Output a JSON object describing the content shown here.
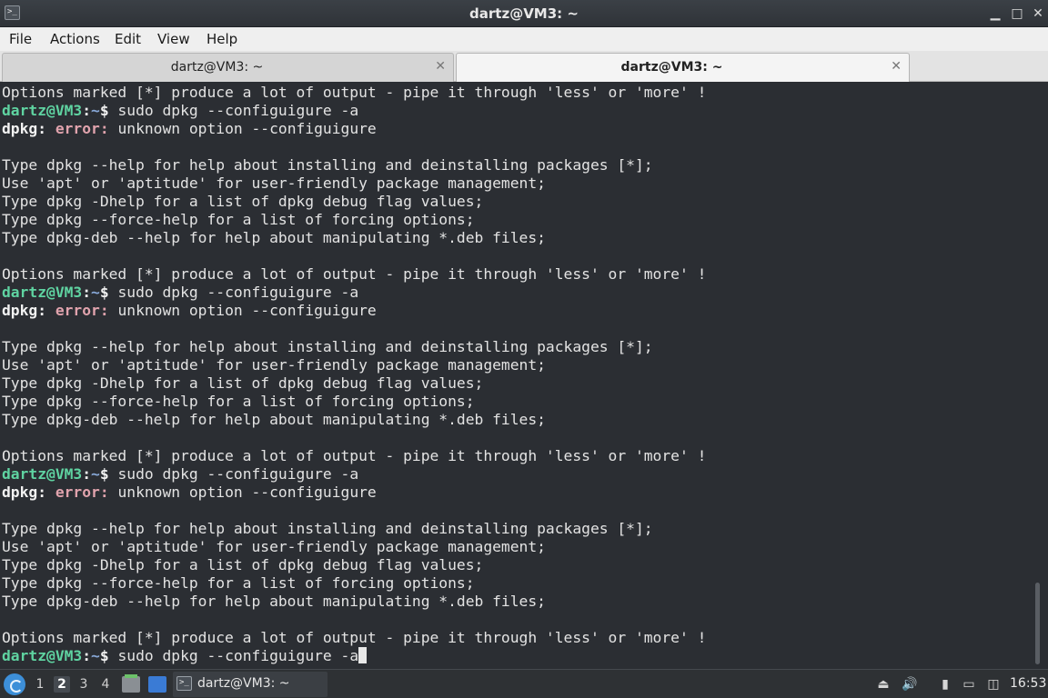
{
  "window": {
    "title": "dartz@VM3: ~",
    "app_icon": ">_",
    "minimize_icon": "▁",
    "maximize_icon": "□",
    "close_icon": "✕"
  },
  "menu": [
    "File",
    "Actions",
    "Edit",
    "View",
    "Help"
  ],
  "tabs": [
    {
      "label": "dartz@VM3: ~",
      "close": "✕",
      "active": false
    },
    {
      "label": "dartz@VM3: ~",
      "close": "✕",
      "active": true
    }
  ],
  "terminal": {
    "lines": [
      {
        "text": "Options marked [*] produce a lot of output - pipe it through 'less' or 'more' !"
      },
      {
        "prompt": {
          "user": "dartz@VM3",
          "sep": ":",
          "path": "~",
          "sym": "$ "
        },
        "cmd": "sudo dpkg --configuigure -a"
      },
      {
        "err": {
          "prog": "dpkg:",
          "label": "error:"
        },
        "text": " unknown option --configuigure"
      },
      {
        "text": ""
      },
      {
        "text": "Type dpkg --help for help about installing and deinstalling packages [*];"
      },
      {
        "text": "Use 'apt' or 'aptitude' for user-friendly package management;"
      },
      {
        "text": "Type dpkg -Dhelp for a list of dpkg debug flag values;"
      },
      {
        "text": "Type dpkg --force-help for a list of forcing options;"
      },
      {
        "text": "Type dpkg-deb --help for help about manipulating *.deb files;"
      },
      {
        "text": ""
      },
      {
        "text": "Options marked [*] produce a lot of output - pipe it through 'less' or 'more' !"
      },
      {
        "prompt": {
          "user": "dartz@VM3",
          "sep": ":",
          "path": "~",
          "sym": "$ "
        },
        "cmd": "sudo dpkg --configuigure -a"
      },
      {
        "err": {
          "prog": "dpkg:",
          "label": "error:"
        },
        "text": " unknown option --configuigure"
      },
      {
        "text": ""
      },
      {
        "text": "Type dpkg --help for help about installing and deinstalling packages [*];"
      },
      {
        "text": "Use 'apt' or 'aptitude' for user-friendly package management;"
      },
      {
        "text": "Type dpkg -Dhelp for a list of dpkg debug flag values;"
      },
      {
        "text": "Type dpkg --force-help for a list of forcing options;"
      },
      {
        "text": "Type dpkg-deb --help for help about manipulating *.deb files;"
      },
      {
        "text": ""
      },
      {
        "text": "Options marked [*] produce a lot of output - pipe it through 'less' or 'more' !"
      },
      {
        "prompt": {
          "user": "dartz@VM3",
          "sep": ":",
          "path": "~",
          "sym": "$ "
        },
        "cmd": "sudo dpkg --configuigure -a"
      },
      {
        "err": {
          "prog": "dpkg:",
          "label": "error:"
        },
        "text": " unknown option --configuigure"
      },
      {
        "text": ""
      },
      {
        "text": "Type dpkg --help for help about installing and deinstalling packages [*];"
      },
      {
        "text": "Use 'apt' or 'aptitude' for user-friendly package management;"
      },
      {
        "text": "Type dpkg -Dhelp for a list of dpkg debug flag values;"
      },
      {
        "text": "Type dpkg --force-help for a list of forcing options;"
      },
      {
        "text": "Type dpkg-deb --help for help about manipulating *.deb files;"
      },
      {
        "text": ""
      },
      {
        "text": "Options marked [*] produce a lot of output - pipe it through 'less' or 'more' !"
      },
      {
        "prompt": {
          "user": "dartz@VM3",
          "sep": ":",
          "path": "~",
          "sym": "$ "
        },
        "cmd": "sudo dpkg --configuigure -a",
        "cursor": true
      }
    ]
  },
  "taskbar": {
    "workspaces": [
      "1",
      "2",
      "3",
      "4"
    ],
    "active_workspace": "2",
    "task_label": "dartz@VM3: ~",
    "task_icon": ">_",
    "tray_icons": [
      "⏏",
      "🔊",
      "▮",
      "▭",
      "◫"
    ],
    "clock": "16:53"
  },
  "colors": {
    "prompt_user": "#5fd3a1",
    "prompt_path": "#88a8d8",
    "error": "#e0a3ad",
    "terminal_bg": "#2b2e33",
    "terminal_fg": "#e3e3e3"
  }
}
